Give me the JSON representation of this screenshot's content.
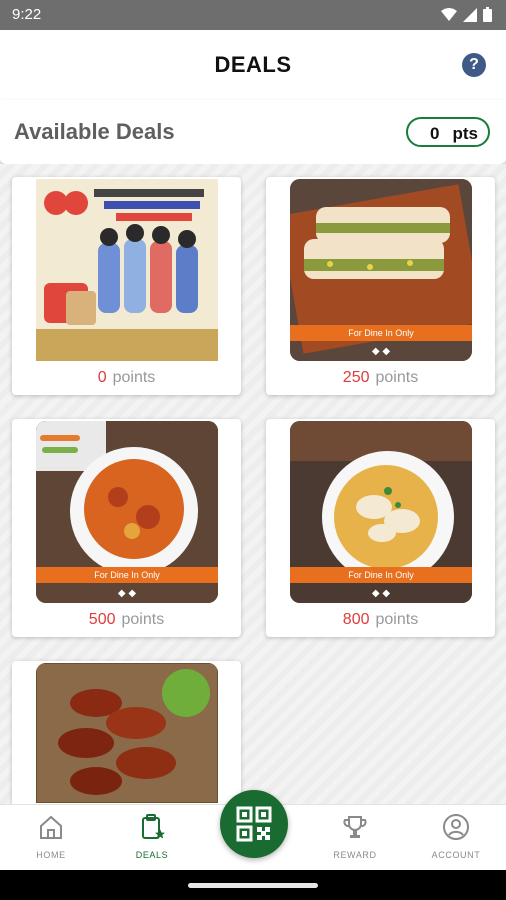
{
  "status": {
    "time": "9:22"
  },
  "header": {
    "title": "DEALS",
    "help": "?"
  },
  "available": {
    "title": "Available Deals",
    "points_value": "0",
    "points_unit": "pts"
  },
  "deals": [
    {
      "points": "0",
      "unit": "points",
      "image": "member-promo-image"
    },
    {
      "points": "250",
      "unit": "points",
      "image": "toast-sandwich-image",
      "banner": "For Dine In Only"
    },
    {
      "points": "500",
      "unit": "points",
      "image": "curry-vegetables-image",
      "banner": "For Dine In Only"
    },
    {
      "points": "800",
      "unit": "points",
      "image": "dumpling-soup-image",
      "banner": "For Dine In Only"
    },
    {
      "points": "",
      "unit": "",
      "image": "chicken-wings-image"
    }
  ],
  "nav": {
    "home": "HOME",
    "deals": "DEALS",
    "reward": "REWARD",
    "account": "ACCOUNT"
  },
  "colors": {
    "brand_green": "#1a6b32",
    "accent_red": "#e03b3b",
    "banner_orange": "#e86f1e"
  }
}
